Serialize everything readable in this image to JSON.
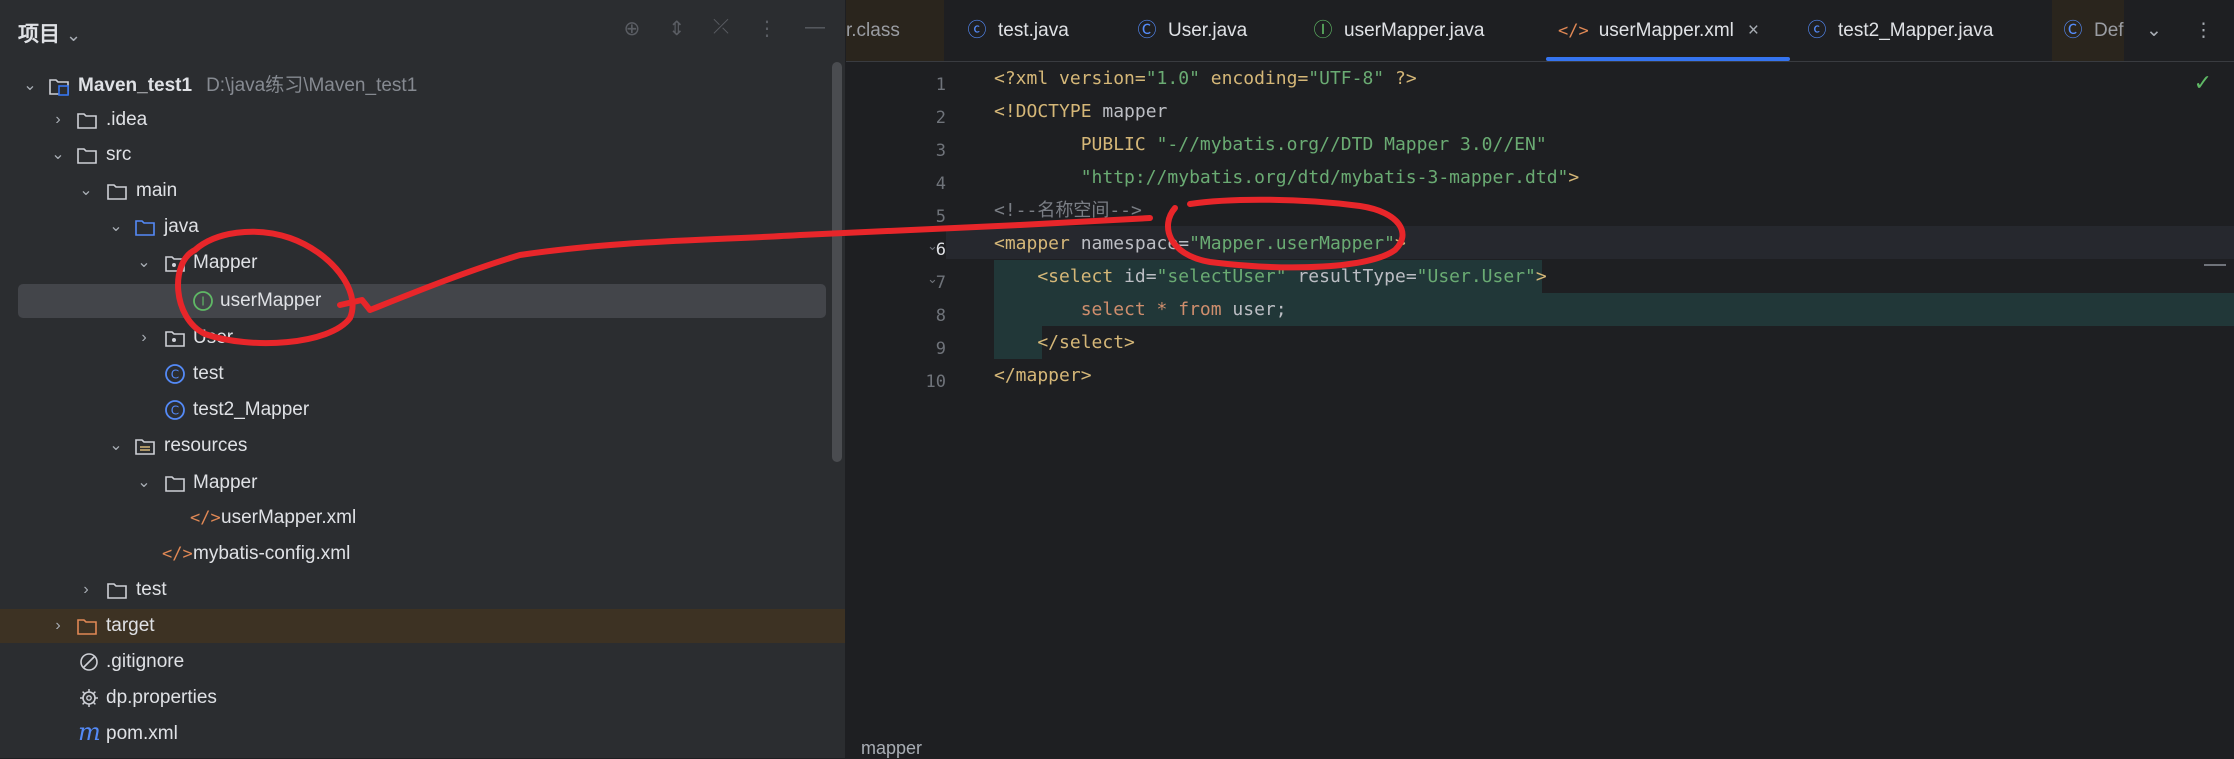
{
  "project_panel": {
    "title": "项目",
    "tree": [
      {
        "label": "Maven_test1",
        "path": "D:\\java练习\\Maven_test1"
      },
      {
        "label": ".idea"
      },
      {
        "label": "src"
      },
      {
        "label": "main"
      },
      {
        "label": "java"
      },
      {
        "label": "Mapper"
      },
      {
        "label": "userMapper"
      },
      {
        "label": "User"
      },
      {
        "label": "test"
      },
      {
        "label": "test2_Mapper"
      },
      {
        "label": "resources"
      },
      {
        "label": "Mapper"
      },
      {
        "label": "userMapper.xml"
      },
      {
        "label": "mybatis-config.xml"
      },
      {
        "label": "test"
      },
      {
        "label": "target"
      },
      {
        "label": ".gitignore"
      },
      {
        "label": "dp.properties"
      },
      {
        "label": "pom.xml"
      }
    ]
  },
  "tabs": [
    {
      "label": "r.class"
    },
    {
      "label": "test.java"
    },
    {
      "label": "User.java"
    },
    {
      "label": "userMapper.java"
    },
    {
      "label": "userMapper.xml",
      "close": "×"
    },
    {
      "label": "test2_Mapper.java"
    },
    {
      "label": "Def"
    }
  ],
  "editor": {
    "line_numbers": [
      "1",
      "2",
      "3",
      "4",
      "5",
      "6",
      "7",
      "8",
      "9",
      "10"
    ],
    "lines": {
      "l1": {
        "a": "<?xml version=",
        "b": "\"1.0\"",
        "c": " encoding=",
        "d": "\"UTF-8\"",
        "e": " ?>"
      },
      "l2": {
        "a": "<!DOCTYPE ",
        "b": "mapper"
      },
      "l3": {
        "a": "        PUBLIC ",
        "b": "\"-//mybatis.org//DTD Mapper 3.0//EN\""
      },
      "l4": {
        "a": "        ",
        "b": "\"http://mybatis.org/dtd/mybatis-3-mapper.dtd\"",
        "c": ">"
      },
      "l5": {
        "a": "<!--名称空间-->"
      },
      "l6": {
        "a": "<mapper ",
        "b": "namespace=",
        "c": "\"Mapper.userMapper\"",
        "d": ">"
      },
      "l7": {
        "a": "    <select ",
        "b": "id=",
        "c": "\"selectUser\"",
        "d": " resultType=",
        "e": "\"User.User\"",
        "f": ">"
      },
      "l8": {
        "a": "        select * from ",
        "b": "user;"
      },
      "l9": {
        "a": "    </select>"
      },
      "l10": {
        "a": "</mapper>"
      }
    }
  },
  "status_bar": {
    "breadcrumb": "mapper"
  },
  "colors": {
    "accent": "#3574f0",
    "annotation": "#e8262a"
  }
}
